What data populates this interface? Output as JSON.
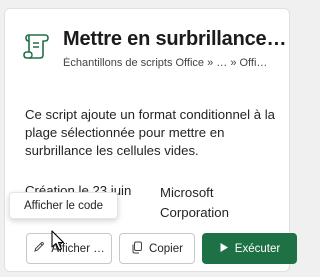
{
  "card": {
    "title": "Mettre en surbrillance…",
    "breadcrumb": "Échantillons de scripts Office » … » Offi…",
    "description": "Ce script ajoute un format conditionnel à la plage sélectionnée pour mettre en surbrillance les cellules vides.",
    "created": "Création le 23 juin",
    "author": "Microsoft Corporation",
    "icon": "script-document-icon"
  },
  "actions": {
    "view_label": "Afficher …",
    "copy_label": "Copier",
    "run_label": "Exécuter"
  },
  "tooltip": {
    "text": "Afficher le code"
  },
  "colors": {
    "accent": "#1e7145",
    "card_background": "#ffffff",
    "page_background": "#f0f0f0"
  }
}
